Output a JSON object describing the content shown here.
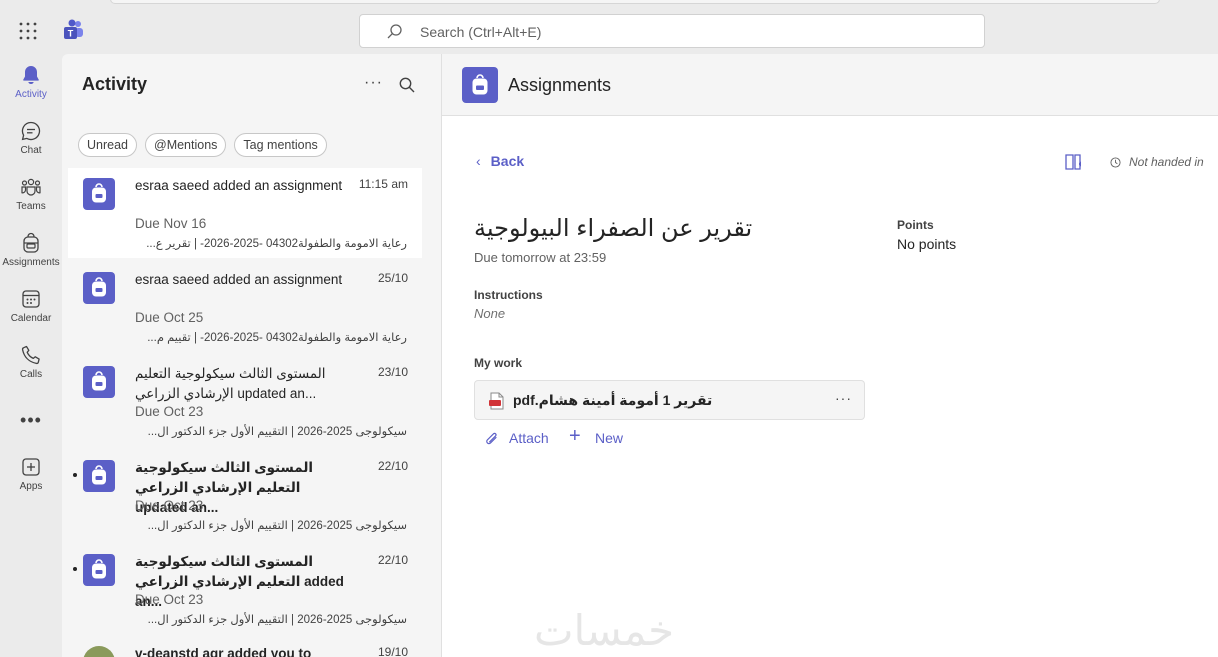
{
  "topbar": {
    "search_placeholder": "Search (Ctrl+Alt+E)",
    "icons": [
      "app-launcher-grid-icon",
      "teams-logo-icon",
      "search-icon"
    ]
  },
  "rail": {
    "items": [
      {
        "label": "Activity",
        "icon": "bell-icon",
        "active": true
      },
      {
        "label": "Chat",
        "icon": "chat-icon"
      },
      {
        "label": "Teams",
        "icon": "teams-icon"
      },
      {
        "label": "Assignments",
        "icon": "backpack-icon"
      },
      {
        "label": "Calendar",
        "icon": "calendar-icon"
      },
      {
        "label": "Calls",
        "icon": "phone-icon"
      },
      {
        "label": "Apps",
        "icon": "add-app-icon"
      }
    ],
    "more": "•••"
  },
  "activity": {
    "title": "Activity",
    "more": "···",
    "chips": [
      "Unread",
      "@Mentions",
      "Tag mentions"
    ],
    "items": [
      {
        "line1": "esraa saeed added an assignment",
        "time": "11:15 am",
        "due": "Due Nov 16",
        "sub": "رعاية الامومة والطفولة04302 -2025-2026- | تقرير ع...",
        "unread": false,
        "bold": false,
        "selected": true
      },
      {
        "line1": "esraa saeed added an assignment",
        "time": "25/10",
        "due": "Due Oct 25",
        "sub": "رعاية الامومة والطفولة04302 -2025-2026- | تقييم م...",
        "unread": false,
        "bold": false,
        "selected": false
      },
      {
        "line1": "المستوى الثالث سيكولوجية التعليم الإرشادي الزراعي updated an...",
        "time": "23/10",
        "due": "Due Oct 23",
        "sub": "سيكولوجى 2025-2026 | التقييم الأول جزء الدكتور ال...",
        "unread": false,
        "bold": false,
        "selected": false
      },
      {
        "line1": "المستوى الثالث سيكولوجية التعليم الإرشادي الزراعي updated an...",
        "time": "22/10",
        "due": "Due Oct 23",
        "sub": "سيكولوجى 2025-2026 | التقييم الأول جزء الدكتور ال...",
        "unread": true,
        "bold": true,
        "selected": false
      },
      {
        "line1": "المستوى الثالث سيكولوجية التعليم الإرشادي الزراعي added an...",
        "time": "22/10",
        "due": "Due Oct 23",
        "sub": "سيكولوجى 2025-2026 | التقييم الأول جزء الدكتور ال...",
        "unread": true,
        "bold": true,
        "selected": false
      },
      {
        "line1": "v-deanstd agr added you to",
        "time": "19/10",
        "unread": false,
        "bold": true
      }
    ]
  },
  "header": {
    "app_title": "Assignments"
  },
  "assignment": {
    "back_label": "Back",
    "status": "Not handed in",
    "title": "تقرير عن الصفراء البيولوجية",
    "due": "Due tomorrow at 23:59",
    "points_label": "Points",
    "points_value": "No points",
    "instructions_label": "Instructions",
    "instructions_value": "None",
    "my_work_label": "My work",
    "file_name": "تقرير 1 أمومة أمينة هشام.pdf",
    "file_more": "···",
    "attach_label": "Attach",
    "new_label": "New"
  },
  "watermark": "خمسات",
  "colors": {
    "accent": "#5b5fc7",
    "rail_bg": "#ebebeb",
    "panel_bg": "#f5f5f5"
  }
}
